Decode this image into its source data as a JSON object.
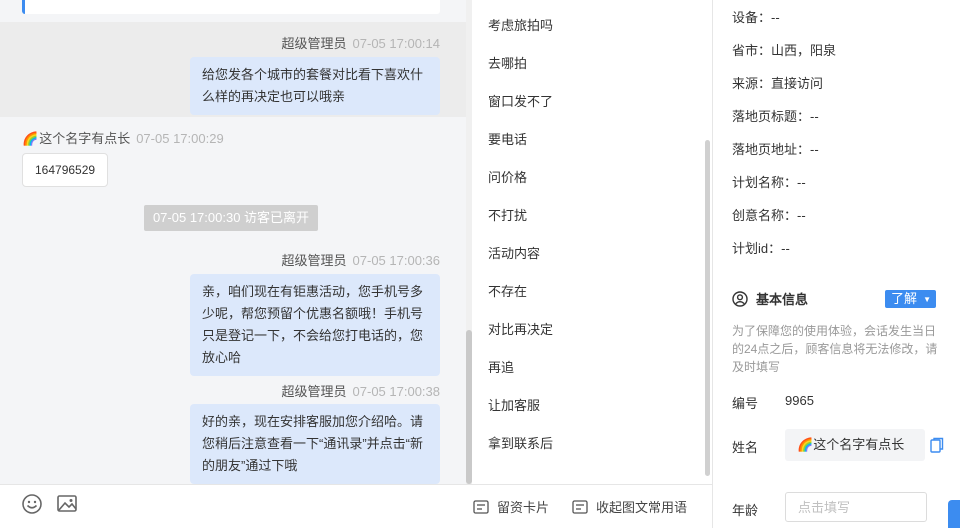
{
  "chat": {
    "messages": [
      {
        "sender": "超级管理员",
        "time": "07-05 17:00:14",
        "text_line1": "给您发各个城市的套餐对比看下喜欢什",
        "text_line2": "么样的再决定也可以哦亲"
      },
      {
        "sender": "这个名字有点长",
        "time": "07-05 17:00:29",
        "text": "164796529"
      },
      {
        "system": "07-05 17:00:30 访客已离开"
      },
      {
        "sender": "超级管理员",
        "time": "07-05 17:00:36",
        "lines": [
          "亲，咱们现在有钜惠活动，您手机号多",
          "少呢，帮您预留个优惠名额哦！手机号",
          "只是登记一下，不会给您打电话的，您",
          "放心哈"
        ]
      },
      {
        "sender": "超级管理员",
        "time": "07-05 17:00:38",
        "lines": [
          "好的亲，现在安排客服加您介绍哈。请",
          "您稍后注意查看一下“通讯录”并点击“新",
          "的朋友”通过下哦"
        ]
      }
    ]
  },
  "toolbar": {
    "emoji_icon": "smile-icon",
    "image_icon": "image-icon",
    "card_label": "留资卡片",
    "collapse_label": "收起图文常用语"
  },
  "quick_replies": [
    "考虑旅拍吗",
    "去哪拍",
    "窗口发不了",
    "要电话",
    "问价格",
    "不打扰",
    "活动内容",
    "不存在",
    "对比再决定",
    "再追",
    "让加客服",
    "拿到联系后"
  ],
  "visitor_info": {
    "device": "设备：--",
    "region": "省市：山西，阳泉",
    "source": "来源：直接访问",
    "landing_title": "落地页标题：--",
    "landing_url": "落地页地址：--",
    "plan_name": "计划名称：--",
    "creative_name": "创意名称：--",
    "plan_id": "计划id：--"
  },
  "basic_info": {
    "title": "基本信息",
    "learn_more": "了解",
    "hint": "为了保障您的使用体验，会话发生当日的24点之后，顾客信息将无法修改，请及时填写",
    "id_label": "编号",
    "id_value": "9965",
    "name_label": "姓名",
    "name_value": "这个名字有点长",
    "age_label": "年龄",
    "age_placeholder": "点击填写"
  },
  "colors": {
    "accent": "#3c8cf0",
    "agent_bubble": "#dce8fb",
    "chat_bg": "#f4f5f7"
  }
}
